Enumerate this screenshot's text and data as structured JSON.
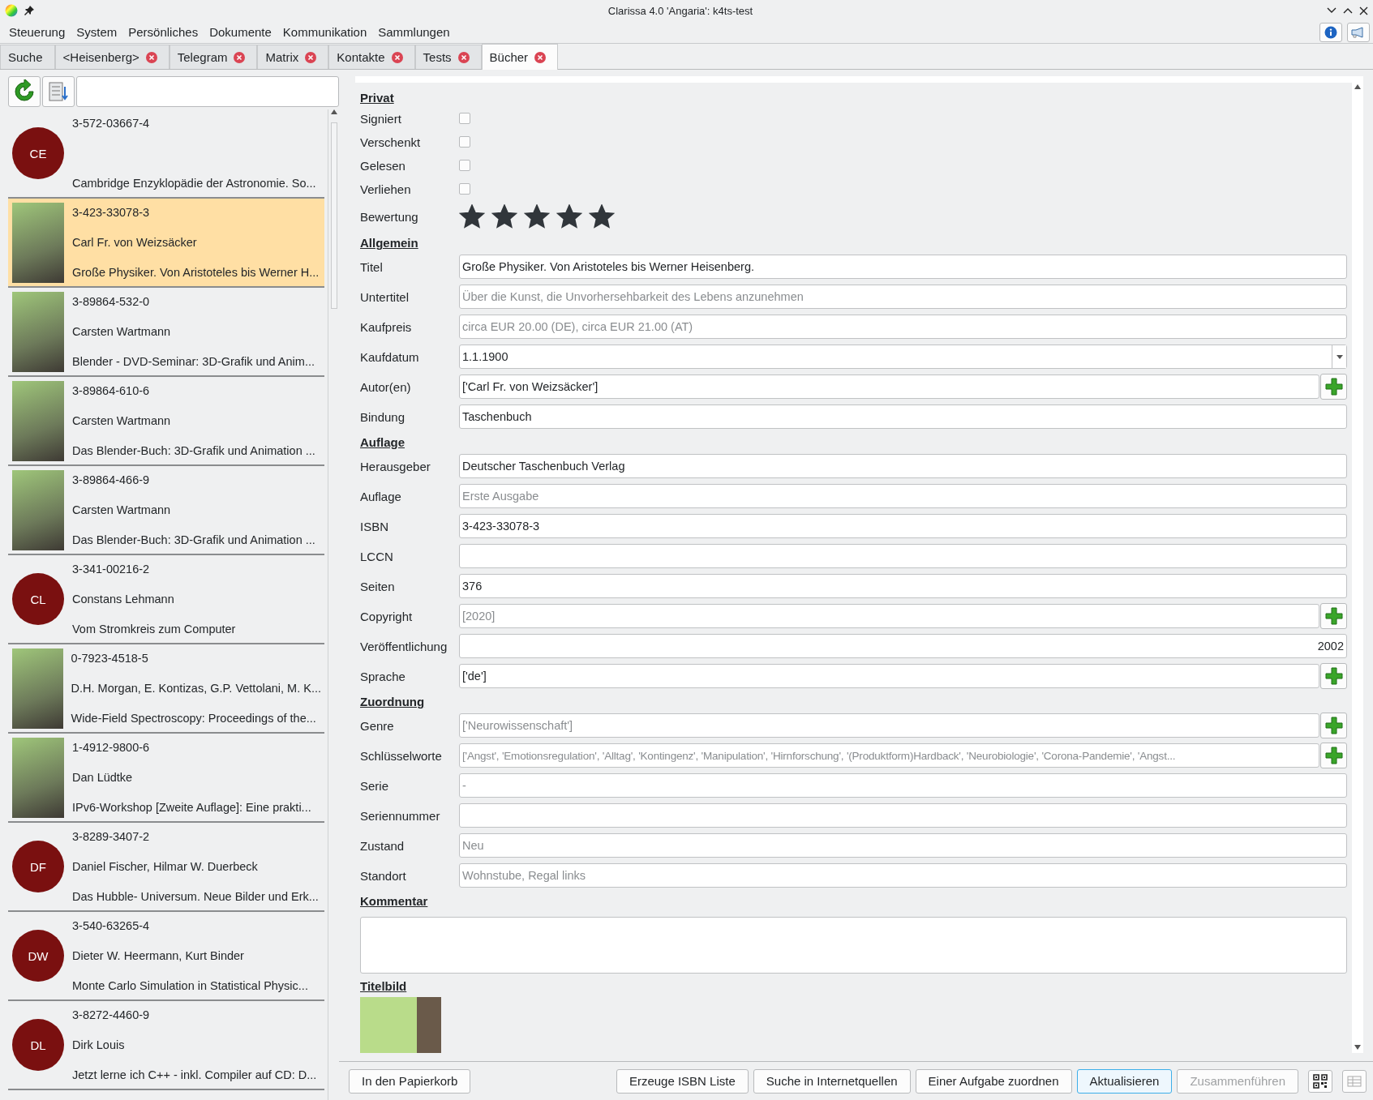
{
  "window": {
    "title": "Clarissa 4.0 'Angaria': k4ts-test"
  },
  "menu": [
    "Steuerung",
    "System",
    "Persönliches",
    "Dokumente",
    "Kommunikation",
    "Sammlungen"
  ],
  "tabs": [
    {
      "label": "Suche",
      "closable": false,
      "selected": false
    },
    {
      "label": "<Heisenberg>",
      "closable": true,
      "selected": false
    },
    {
      "label": "Telegram",
      "closable": true,
      "selected": false
    },
    {
      "label": "Matrix",
      "closable": true,
      "selected": false
    },
    {
      "label": "Kontakte",
      "closable": true,
      "selected": false
    },
    {
      "label": "Tests",
      "closable": true,
      "selected": false
    },
    {
      "label": "Bücher",
      "closable": true,
      "selected": true
    }
  ],
  "books": [
    {
      "kind": "initials",
      "initials": "CE",
      "isbn": "3-572-03667-4",
      "title": "Cambridge Enzyklopädie der Astronomie. So...",
      "selected": false
    },
    {
      "kind": "cover",
      "isbn": "3-423-33078-3",
      "author": "Carl Fr. von Weizsäcker",
      "title": "Große Physiker. Von Aristoteles bis Werner H...",
      "selected": true
    },
    {
      "kind": "cover",
      "isbn": "3-89864-532-0",
      "author": "Carsten Wartmann",
      "title": "Blender - DVD-Seminar: 3D-Grafik und Anim...",
      "selected": false
    },
    {
      "kind": "cover",
      "isbn": "3-89864-610-6",
      "author": "Carsten Wartmann",
      "title": "Das Blender-Buch: 3D-Grafik und Animation ...",
      "selected": false
    },
    {
      "kind": "cover",
      "isbn": "3-89864-466-9",
      "author": "Carsten Wartmann",
      "title": "Das Blender-Buch: 3D-Grafik und Animation ...",
      "selected": false
    },
    {
      "kind": "initials",
      "initials": "CL",
      "isbn": "3-341-00216-2",
      "author": "Constans Lehmann",
      "title": "Vom Stromkreis zum Computer",
      "selected": false
    },
    {
      "kind": "cover",
      "isbn": "0-7923-4518-5",
      "author": "D.H. Morgan, E. Kontizas, G.P. Vettolani, M. K...",
      "title": "Wide-Field Spectroscopy: Proceedings of the...",
      "selected": false
    },
    {
      "kind": "cover",
      "isbn": "1-4912-9800-6",
      "author": "Dan Lüdtke",
      "title": "IPv6-Workshop [Zweite Auflage]: Eine prakti...",
      "selected": false
    },
    {
      "kind": "initials",
      "initials": "DF",
      "isbn": "3-8289-3407-2",
      "author": "Daniel Fischer, Hilmar W. Duerbeck",
      "title": "Das Hubble- Universum. Neue Bilder und Erk...",
      "selected": false
    },
    {
      "kind": "initials",
      "initials": "DW",
      "isbn": "3-540-63265-4",
      "author": "Dieter W. Heermann, Kurt Binder",
      "title": "Monte Carlo Simulation in Statistical Physic...",
      "selected": false
    },
    {
      "kind": "initials",
      "initials": "DL",
      "isbn": "3-8272-4460-9",
      "author": "Dirk Louis",
      "title": "Jetzt lerne ich C++ - inkl. Compiler auf CD: D...",
      "selected": false
    }
  ],
  "form": {
    "sections": [
      {
        "heading": "Privat",
        "rows": [
          {
            "kind": "checkbox",
            "label": "Signiert",
            "checked": false
          },
          {
            "kind": "checkbox",
            "label": "Verschenkt",
            "checked": false
          },
          {
            "kind": "checkbox",
            "label": "Gelesen",
            "checked": false
          },
          {
            "kind": "checkbox",
            "label": "Verliehen",
            "checked": false
          },
          {
            "kind": "stars",
            "label": "Bewertung",
            "stars": 5
          }
        ]
      },
      {
        "heading": "Allgemein",
        "rows": [
          {
            "kind": "text",
            "label": "Titel",
            "value": "Große Physiker. Von Aristoteles bis Werner Heisenberg."
          },
          {
            "kind": "text",
            "label": "Untertitel",
            "placeholder": "Über die Kunst, die Unvorhersehbarkeit des Lebens anzunehmen"
          },
          {
            "kind": "text",
            "label": "Kaufpreis",
            "placeholder": "circa EUR 20.00 (DE), circa EUR 21.00 (AT)"
          },
          {
            "kind": "date",
            "label": "Kaufdatum",
            "value": "1.1.1900"
          },
          {
            "kind": "list",
            "label": "Autor(en)",
            "value": "['Carl Fr. von Weizsäcker']"
          },
          {
            "kind": "text",
            "label": "Bindung",
            "value": "Taschenbuch"
          }
        ]
      },
      {
        "heading": "Auflage",
        "rows": [
          {
            "kind": "text",
            "label": "Herausgeber",
            "value": "Deutscher Taschenbuch Verlag"
          },
          {
            "kind": "text",
            "label": "Auflage",
            "placeholder": "Erste Ausgabe"
          },
          {
            "kind": "text",
            "label": "ISBN",
            "value": "3-423-33078-3"
          },
          {
            "kind": "text",
            "label": "LCCN"
          },
          {
            "kind": "text",
            "label": "Seiten",
            "value": "376"
          },
          {
            "kind": "list",
            "label": "Copyright",
            "placeholder": "[2020]"
          },
          {
            "kind": "number",
            "label": "Veröffentlichung",
            "value": "2002"
          },
          {
            "kind": "list",
            "label": "Sprache",
            "value": "['de']"
          }
        ]
      },
      {
        "heading": "Zuordnung",
        "rows": [
          {
            "kind": "list",
            "label": "Genre",
            "placeholder": "['Neurowissenschaft']"
          },
          {
            "kind": "list",
            "label": "Schlüsselworte",
            "placeholder": "['Angst', 'Emotionsregulation', 'Alltag', 'Kontingenz', 'Manipulation', 'Hirnforschung', '(Produktform)Hardback', 'Neurobiologie', 'Corona-Pandemie', 'Angst..."
          },
          {
            "kind": "text",
            "label": "Serie",
            "placeholder": "-"
          },
          {
            "kind": "text",
            "label": "Seriennummer"
          },
          {
            "kind": "text",
            "label": "Zustand",
            "placeholder": "Neu"
          },
          {
            "kind": "text",
            "label": "Standort",
            "placeholder": "Wohnstube, Regal links"
          }
        ]
      },
      {
        "heading": "Kommentar",
        "rows": [
          {
            "kind": "textarea"
          }
        ]
      },
      {
        "heading": "Titelbild",
        "rows": [
          {
            "kind": "image"
          }
        ]
      }
    ]
  },
  "buttons": [
    {
      "label": "In den Papierkorb",
      "disabled": false,
      "default": false
    },
    {
      "label": "Erzeuge ISBN Liste",
      "disabled": false,
      "default": false
    },
    {
      "label": "Suche in Internetquellen",
      "disabled": false,
      "default": false
    },
    {
      "label": "Einer Aufgabe zuordnen",
      "disabled": false,
      "default": false
    },
    {
      "label": "Aktualisieren",
      "disabled": false,
      "default": true
    },
    {
      "label": "Zusammenführen",
      "disabled": true,
      "default": false
    }
  ]
}
